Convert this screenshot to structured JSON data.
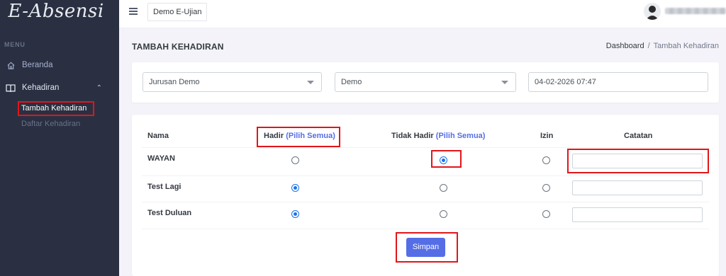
{
  "brand": {
    "logo_text": "E-Absensi"
  },
  "sidebar": {
    "menu_title": "MENU",
    "items": [
      {
        "label": "Beranda",
        "icon": "home-icon"
      },
      {
        "label": "Kehadiran",
        "icon": "book-icon",
        "expanded": true,
        "children": [
          {
            "label": "Tambah Kehadiran",
            "active": true
          },
          {
            "label": "Daftar Kehadiran",
            "active": false
          }
        ]
      }
    ]
  },
  "topbar": {
    "app_button": "Demo E-Ujian"
  },
  "page": {
    "title": "TAMBAH KEHADIRAN",
    "breadcrumb": {
      "home": "Dashboard",
      "current": "Tambah Kehadiran"
    }
  },
  "filters": {
    "jurusan": "Jurusan Demo",
    "kelas": "Demo",
    "datetime": "04-02-2026 07:47"
  },
  "table": {
    "headers": {
      "nama": "Nama",
      "hadir": "Hadir",
      "tidak_hadir": "Tidak Hadir",
      "izin": "Izin",
      "catatan": "Catatan",
      "pilih_semua": "(Pilih Semua)"
    },
    "rows": [
      {
        "nama": "WAYAN",
        "status": "tidak_hadir",
        "catatan": ""
      },
      {
        "nama": "Test Lagi",
        "status": "hadir",
        "catatan": ""
      },
      {
        "nama": "Test Duluan",
        "status": "hadir",
        "catatan": ""
      }
    ]
  },
  "actions": {
    "save_label": "Simpan"
  },
  "colors": {
    "sidebar": "#2a3042",
    "accent": "#556ee6",
    "highlight": "#e0161a"
  }
}
